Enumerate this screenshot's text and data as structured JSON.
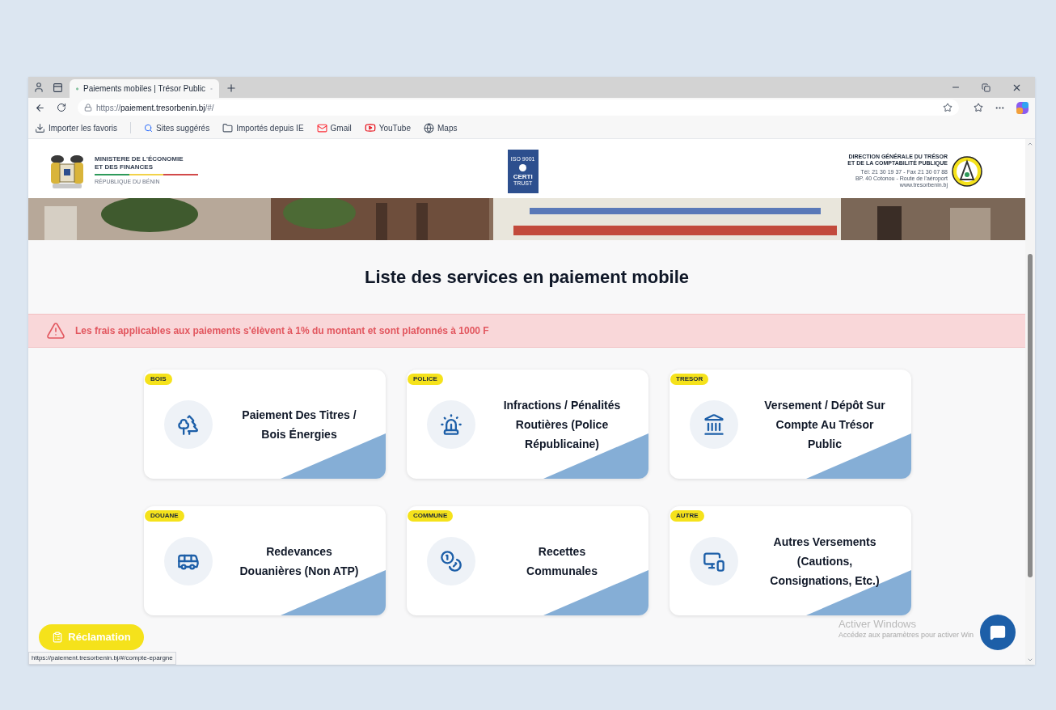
{
  "browser": {
    "tab_title": "Paiements mobiles | Trésor Public",
    "url_prefix": "https://",
    "url_host": "paiement.tresorbenin.bj",
    "url_path": "/#/",
    "bookmarks": [
      {
        "kind": "import",
        "label": "Importer les favoris"
      },
      {
        "kind": "search",
        "label": "Sites suggérés"
      },
      {
        "kind": "folder",
        "label": "Importés depuis IE"
      },
      {
        "kind": "gmail",
        "label": "Gmail"
      },
      {
        "kind": "youtube",
        "label": "YouTube"
      },
      {
        "kind": "globe",
        "label": "Maps"
      }
    ],
    "status_url": "https://paiement.tresorbenin.bj/#/compte-epargne"
  },
  "header": {
    "ministry": [
      "MINISTERE DE L'ÉCONOMIE",
      "ET DES FINANCES"
    ],
    "country": "RÉPUBLIQUE DU BÉNIN",
    "cert": [
      "ISO 9001",
      "CERTI",
      "TRUST"
    ],
    "direction": [
      "DIRECTION GÉNÉRALE DU TRÉSOR",
      "ET DE LA COMPTABILITÉ PUBLIQUE"
    ],
    "contact": [
      "Tél: 21 30 19 37 - Fax 21 30 07 88",
      "BP. 40 Cotonou - Route de l'aéroport",
      "www.tresorbenin.bj"
    ]
  },
  "page_title": "Liste des services en paiement mobile",
  "alert": "Les frais applicables aux paiements s'élèvent à 1% du montant et sont plafonnés à 1000 F",
  "services": [
    {
      "tag": "BOIS",
      "kind": "trees",
      "title": "Paiement Des Titres / Bois Énergies"
    },
    {
      "tag": "POLICE",
      "kind": "siren",
      "title": "Infractions / Pénalités Routières (Police Républicaine)"
    },
    {
      "tag": "TRESOR",
      "kind": "bank",
      "title": "Versement / Dépôt Sur Compte Au Trésor Public"
    },
    {
      "tag": "DOUANE",
      "kind": "bus",
      "title": "Redevances Douanières (Non ATP)"
    },
    {
      "tag": "COMMUNE",
      "kind": "coins",
      "title": "Recettes Communales"
    },
    {
      "tag": "AUTRE",
      "kind": "devices",
      "title": "Autres Versements (Cautions, Consignations, Etc.)"
    }
  ],
  "reclamation": "Réclamation",
  "os_notice": [
    "Activer Windows",
    "Accédez aux paramètres pour activer Win"
  ]
}
